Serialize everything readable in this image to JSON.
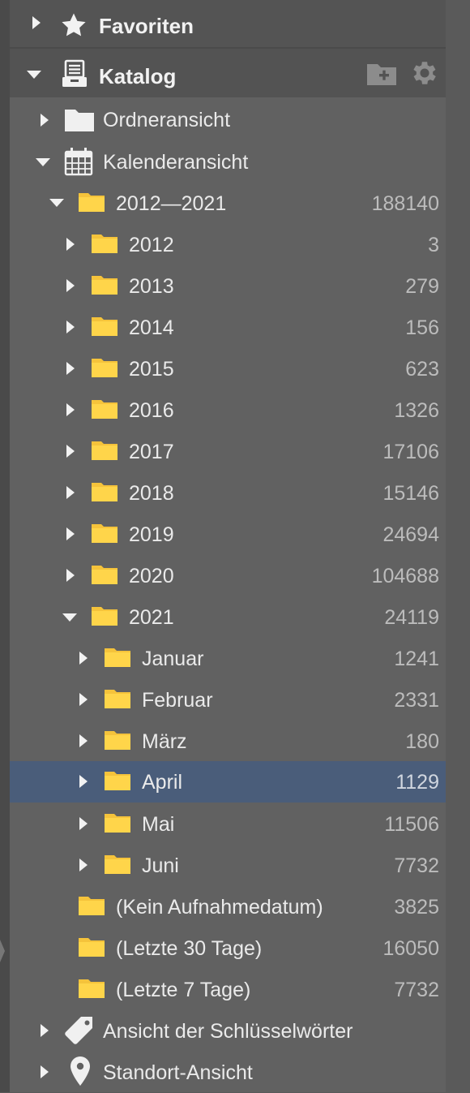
{
  "sections": {
    "favorites": {
      "label": "Favoriten",
      "icon": "star-icon"
    },
    "catalog": {
      "label": "Katalog",
      "icon": "catalog-icon",
      "actions": [
        "add-folder-icon",
        "gear-icon"
      ]
    }
  },
  "tree": {
    "folder_view": {
      "label": "Ordneransicht",
      "icon": "folder-icon"
    },
    "calendar_view": {
      "label": "Kalenderansicht",
      "icon": "calendar-icon"
    },
    "range": {
      "label": "2012—2021",
      "count": "188140"
    },
    "years": [
      {
        "label": "2012",
        "count": "3"
      },
      {
        "label": "2013",
        "count": "279"
      },
      {
        "label": "2014",
        "count": "156"
      },
      {
        "label": "2015",
        "count": "623"
      },
      {
        "label": "2016",
        "count": "1326"
      },
      {
        "label": "2017",
        "count": "17106"
      },
      {
        "label": "2018",
        "count": "15146"
      },
      {
        "label": "2019",
        "count": "24694"
      },
      {
        "label": "2020",
        "count": "104688"
      },
      {
        "label": "2021",
        "count": "24119"
      }
    ],
    "months": [
      {
        "label": "Januar",
        "count": "1241"
      },
      {
        "label": "Februar",
        "count": "2331"
      },
      {
        "label": "März",
        "count": "180"
      },
      {
        "label": "April",
        "count": "1129",
        "selected": true
      },
      {
        "label": "Mai",
        "count": "11506"
      },
      {
        "label": "Juni",
        "count": "7732"
      }
    ],
    "extras": [
      {
        "label": "(Kein Aufnahmedatum)",
        "count": "3825"
      },
      {
        "label": "(Letzte 30 Tage)",
        "count": "16050"
      },
      {
        "label": "(Letzte 7 Tage)",
        "count": "7732"
      }
    ],
    "keywords_view": {
      "label": "Ansicht der Schlüsselwörter",
      "icon": "tag-icon"
    },
    "location_view": {
      "label": "Standort-Ansicht",
      "icon": "location-pin-icon"
    }
  },
  "colors": {
    "folder": "#ffd54a",
    "selection": "#4a5d7a",
    "panel": "#616161"
  }
}
